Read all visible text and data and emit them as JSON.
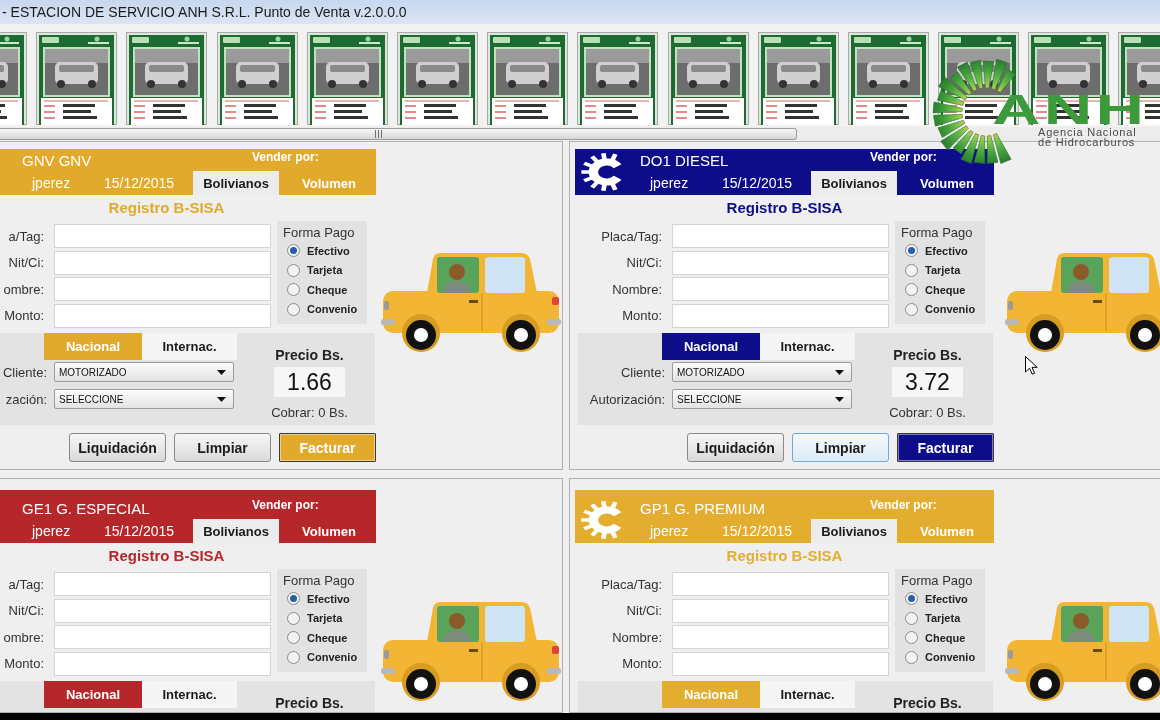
{
  "window": {
    "title": "- ESTACION DE SERVICIO ANH S.R.L. Punto de Venta v.2.0.0.0"
  },
  "vehicle_strip": {
    "cards": [
      {
        "kind": "vehicle_card"
      },
      {
        "kind": "vehicle_card"
      },
      {
        "kind": "vehicle_card"
      },
      {
        "kind": "vehicle_card"
      },
      {
        "kind": "vehicle_card"
      },
      {
        "kind": "vehicle_card"
      },
      {
        "kind": "vehicle_card"
      },
      {
        "kind": "vehicle_card"
      },
      {
        "kind": "vehicle_card"
      },
      {
        "kind": "vehicle_card"
      },
      {
        "kind": "vehicle_card"
      },
      {
        "kind": "vehicle_card"
      },
      {
        "kind": "vehicle_card"
      },
      {
        "kind": "vehicle_card"
      }
    ]
  },
  "panels": [
    {
      "title": "GNV GNV",
      "color": "#e2aa2c",
      "logo": false,
      "sell_by": "Vender por:",
      "user": "jperez",
      "date": "15/12/2015",
      "currency_tabs": [
        {
          "label": "Bolivianos",
          "selected": true
        },
        {
          "label": "Volumen",
          "selected": false
        }
      ],
      "form_title": "Registro B-SISA",
      "fields": [
        {
          "label": "a/Tag:"
        },
        {
          "label": "Nit/Ci:"
        },
        {
          "label": "ombre:"
        },
        {
          "label": "Monto:"
        }
      ],
      "payment": {
        "title": "Forma Pago",
        "options": [
          {
            "label": "Efectivo",
            "selected": true
          },
          {
            "label": "Tarjeta",
            "selected": false
          },
          {
            "label": "Cheque",
            "selected": false
          },
          {
            "label": "Convenio",
            "selected": false
          }
        ]
      },
      "origin_tabs": [
        {
          "label": "Nacional",
          "selected": true
        },
        {
          "label": "Internac.",
          "selected": false
        }
      ],
      "selects": [
        {
          "label": "Cliente:",
          "value": "MOTORIZADO"
        },
        {
          "label": "zación:",
          "value": "SELECCIONE"
        }
      ],
      "price": {
        "label": "Precio Bs.",
        "value": "1.66",
        "charge": "Cobrar: 0 Bs."
      },
      "buttons": [
        {
          "label": "Liquidación",
          "kind": "plain",
          "focused": false
        },
        {
          "label": "Limpiar",
          "kind": "plain",
          "focused": false
        },
        {
          "label": "Facturar",
          "kind": "primary",
          "focused": false
        }
      ]
    },
    {
      "title": "DO1 DIESEL",
      "color": "#0d0d8a",
      "logo": true,
      "sell_by": "Vender por:",
      "user": "jperez",
      "date": "15/12/2015",
      "currency_tabs": [
        {
          "label": "Bolivianos",
          "selected": true
        },
        {
          "label": "Volumen",
          "selected": false
        }
      ],
      "form_title": "Registro B-SISA",
      "fields": [
        {
          "label": "Placa/Tag:"
        },
        {
          "label": "Nit/Ci:"
        },
        {
          "label": "Nombre:"
        },
        {
          "label": "Monto:"
        }
      ],
      "payment": {
        "title": "Forma Pago",
        "options": [
          {
            "label": "Efectivo",
            "selected": true
          },
          {
            "label": "Tarjeta",
            "selected": false
          },
          {
            "label": "Cheque",
            "selected": false
          },
          {
            "label": "Convenio",
            "selected": false
          }
        ]
      },
      "origin_tabs": [
        {
          "label": "Nacional",
          "selected": true
        },
        {
          "label": "Internac.",
          "selected": false
        }
      ],
      "selects": [
        {
          "label": "Cliente:",
          "value": "MOTORIZADO"
        },
        {
          "label": "Autorización:",
          "value": "SELECCIONE"
        }
      ],
      "price": {
        "label": "Precio Bs.",
        "value": "3.72",
        "charge": "Cobrar: 0 Bs."
      },
      "buttons": [
        {
          "label": "Liquidación",
          "kind": "plain",
          "focused": false
        },
        {
          "label": "Limpiar",
          "kind": "plain",
          "focused": true
        },
        {
          "label": "Facturar",
          "kind": "primary",
          "focused": false
        }
      ]
    },
    {
      "title": "GE1 G. ESPECIAL",
      "color": "#b5272b",
      "logo": false,
      "sell_by": "Vender por:",
      "user": "jperez",
      "date": "15/12/2015",
      "currency_tabs": [
        {
          "label": "Bolivianos",
          "selected": true
        },
        {
          "label": "Volumen",
          "selected": false
        }
      ],
      "form_title": "Registro B-SISA",
      "fields": [
        {
          "label": "a/Tag:"
        },
        {
          "label": "Nit/Ci:"
        },
        {
          "label": "ombre:"
        },
        {
          "label": "Monto:"
        }
      ],
      "payment": {
        "title": "Forma Pago",
        "options": [
          {
            "label": "Efectivo",
            "selected": true
          },
          {
            "label": "Tarjeta",
            "selected": false
          },
          {
            "label": "Cheque",
            "selected": false
          },
          {
            "label": "Convenio",
            "selected": false
          }
        ]
      },
      "origin_tabs": [
        {
          "label": "Nacional",
          "selected": true
        },
        {
          "label": "Internac.",
          "selected": false
        }
      ],
      "price": {
        "label": "Precio Bs."
      }
    },
    {
      "title": "GP1 G. PREMIUM",
      "color": "#e3ad30",
      "logo": true,
      "sell_by": "Vender por:",
      "user": "jperez",
      "date": "15/12/2015",
      "currency_tabs": [
        {
          "label": "Bolivianos",
          "selected": true
        },
        {
          "label": "Volumen",
          "selected": false
        }
      ],
      "form_title": "Registro B-SISA",
      "fields": [
        {
          "label": "Placa/Tag:"
        },
        {
          "label": "Nit/Ci:"
        },
        {
          "label": "Nombre:"
        },
        {
          "label": "Monto:"
        }
      ],
      "payment": {
        "title": "Forma Pago",
        "options": [
          {
            "label": "Efectivo",
            "selected": true
          },
          {
            "label": "Tarjeta",
            "selected": false
          },
          {
            "label": "Cheque",
            "selected": false
          },
          {
            "label": "Convenio",
            "selected": false
          }
        ]
      },
      "origin_tabs": [
        {
          "label": "Nacional",
          "selected": true
        },
        {
          "label": "Internac.",
          "selected": false
        }
      ],
      "price": {
        "label": "Precio Bs."
      }
    }
  ],
  "logo": {
    "letters": "ANH",
    "subtitle": "Agencia Nacional de Hidrocarburos"
  }
}
